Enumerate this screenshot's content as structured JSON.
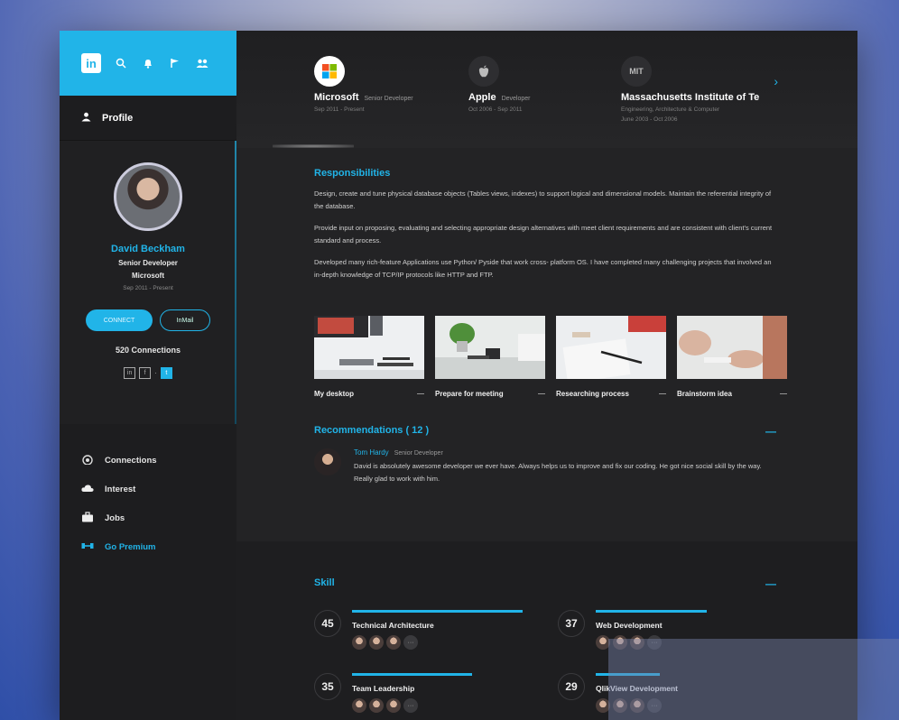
{
  "colors": {
    "accent": "#21b4e8",
    "panel": "#232325",
    "sidebar": "#1d1d1f"
  },
  "topbar": {
    "logo": "in",
    "icons": [
      "search-icon",
      "notification-icon",
      "flag-icon",
      "people-icon"
    ]
  },
  "sidebar": {
    "profile_label": "Profile",
    "name": "David Beckham",
    "title": "Senior Developer",
    "company": "Microsoft",
    "dates": "Sep 2011 - Present",
    "connect_label": "CONNECT",
    "message_label": "InMail",
    "connections": "520 Connections",
    "nav": [
      {
        "label": "Connections",
        "icon": "connections-icon"
      },
      {
        "label": "Interest",
        "icon": "cloud-icon"
      },
      {
        "label": "Jobs",
        "icon": "briefcase-icon"
      },
      {
        "label": "Go Premium",
        "icon": "premium-icon"
      }
    ]
  },
  "experience": [
    {
      "company": "Microsoft",
      "role": "Senior Developer",
      "sub": "Sep 2011 - Present",
      "logo": "microsoft-logo"
    },
    {
      "company": "Apple",
      "role": "Developer",
      "sub": "Oct 2006 - Sep 2011",
      "logo": "apple-logo"
    },
    {
      "company": "Massachusetts Institute of Te",
      "role": "",
      "sub": "Engineering, Architecture & Computer",
      "sub2": "June 2003 - Oct 2006",
      "logo": "mit-logo",
      "logo_text": "MIT"
    }
  ],
  "responsibilities": {
    "title": "Responsibilities",
    "paragraphs": [
      "Design, create and tune physical database objects (Tables views, indexes) to support logical and dimensional models. Maintain the referential integrity of the database.",
      "Provide input on proposing, evaluating and selecting appropriate design alternatives with meet client requirements and are consistent with client's current standard and process.",
      "Developed many rich-feature Applications use Python/ Pyside that work cross- platform OS. I have completed many challenging projects that involved an in-depth knowledge of TCP/IP protocols like HTTP and FTP."
    ]
  },
  "gallery": [
    {
      "caption": "My desktop"
    },
    {
      "caption": "Prepare for meeting"
    },
    {
      "caption": "Researching process"
    },
    {
      "caption": "Brainstorm idea"
    }
  ],
  "recommendations": {
    "title": "Recommendations ( 12 )",
    "items": [
      {
        "name": "Tom Hardy",
        "role": "Senior Developer",
        "text": "David is absolutely awesome developer we ever have. Always helps us to improve and fix our coding. He got nice social skill by the way. Really glad to work with him."
      }
    ]
  },
  "skills": {
    "title": "Skill",
    "items": [
      {
        "count": "45",
        "name": "Technical Architecture",
        "bar_fraction": 0.85
      },
      {
        "count": "37",
        "name": "Web Development",
        "bar_fraction": 0.78
      },
      {
        "count": "35",
        "name": "Team Leadership",
        "bar_fraction": 0.6
      },
      {
        "count": "29",
        "name": "QlikView Development",
        "bar_fraction": 0.45
      }
    ]
  }
}
